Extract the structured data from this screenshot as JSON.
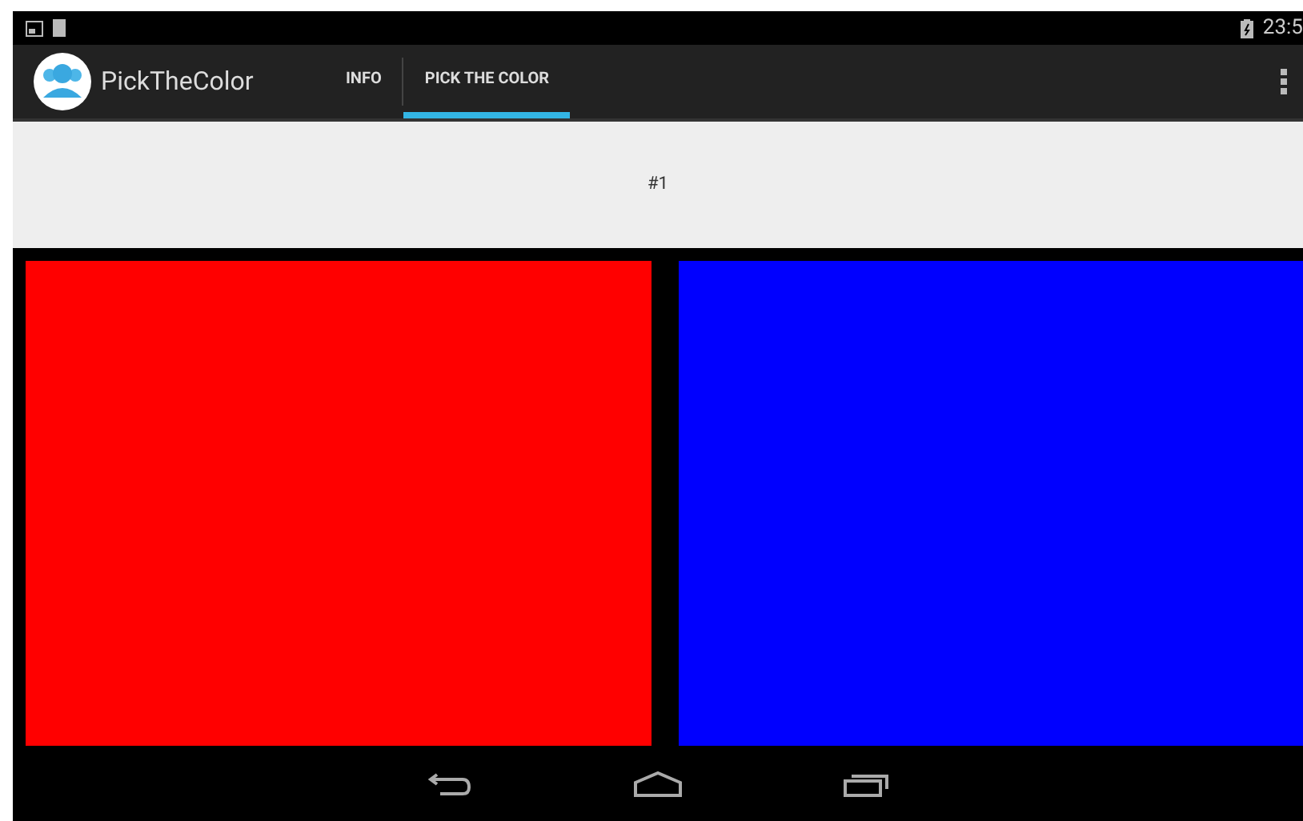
{
  "status_bar": {
    "time": "23:5"
  },
  "action_bar": {
    "title": "PickTheColor",
    "tabs": [
      {
        "label": "INFO",
        "selected": false
      },
      {
        "label": "PICK THE COLOR",
        "selected": true
      }
    ]
  },
  "round": {
    "label": "#1"
  },
  "swatches": [
    {
      "color": "#ff0000"
    },
    {
      "color": "#0000ff"
    }
  ]
}
